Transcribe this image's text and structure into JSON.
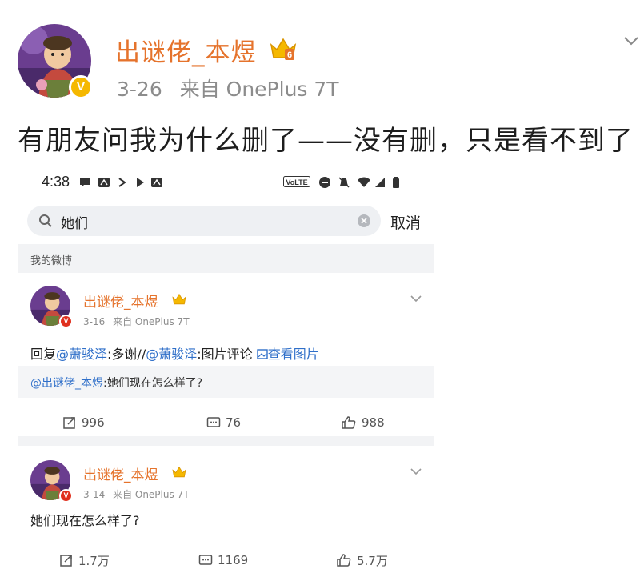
{
  "post": {
    "author": "出谜佬_本煜",
    "date": "3-26",
    "source": "来自 OnePlus 7T",
    "text": "有朋友问我为什么删了——没有删，只是看不到了"
  },
  "screenshot": {
    "status_bar": {
      "time": "4:38",
      "volte": "VoLTE",
      "icons": [
        "chat-icon",
        "app-icon",
        "arrow-icon",
        "play-icon",
        "app-icon",
        "volte-icon",
        "block-icon",
        "mute-icon",
        "wifi-icon",
        "signal-icon",
        "battery-icon"
      ]
    },
    "search": {
      "value": "她们",
      "cancel_label": "取消"
    },
    "section_label": "我的微博",
    "results": [
      {
        "author": "出谜佬_本煜",
        "date": "3-16",
        "source": "来自 OnePlus 7T",
        "reply_prefix": "回复",
        "mention1": "@萧骏泽",
        "reply_mid": ":多谢//",
        "mention2": "@萧骏泽",
        "reply_end": ":图片评论",
        "image_link": "查看图片",
        "quote_user": "@出谜佬_本煜",
        "quote_text": ":她们现在怎么样了?",
        "reposts": "996",
        "comments": "76",
        "likes": "988"
      },
      {
        "author": "出谜佬_本煜",
        "date": "3-14",
        "source": "来自 OnePlus 7T",
        "text": "她们现在怎么样了?",
        "reposts": "1.7万",
        "comments": "1169",
        "likes": "5.7万"
      }
    ]
  },
  "colors": {
    "name_orange": "#e5732c",
    "mention_blue": "#2f6fc9",
    "vip_gold": "#f5b800",
    "verify_red": "#e0301e"
  }
}
